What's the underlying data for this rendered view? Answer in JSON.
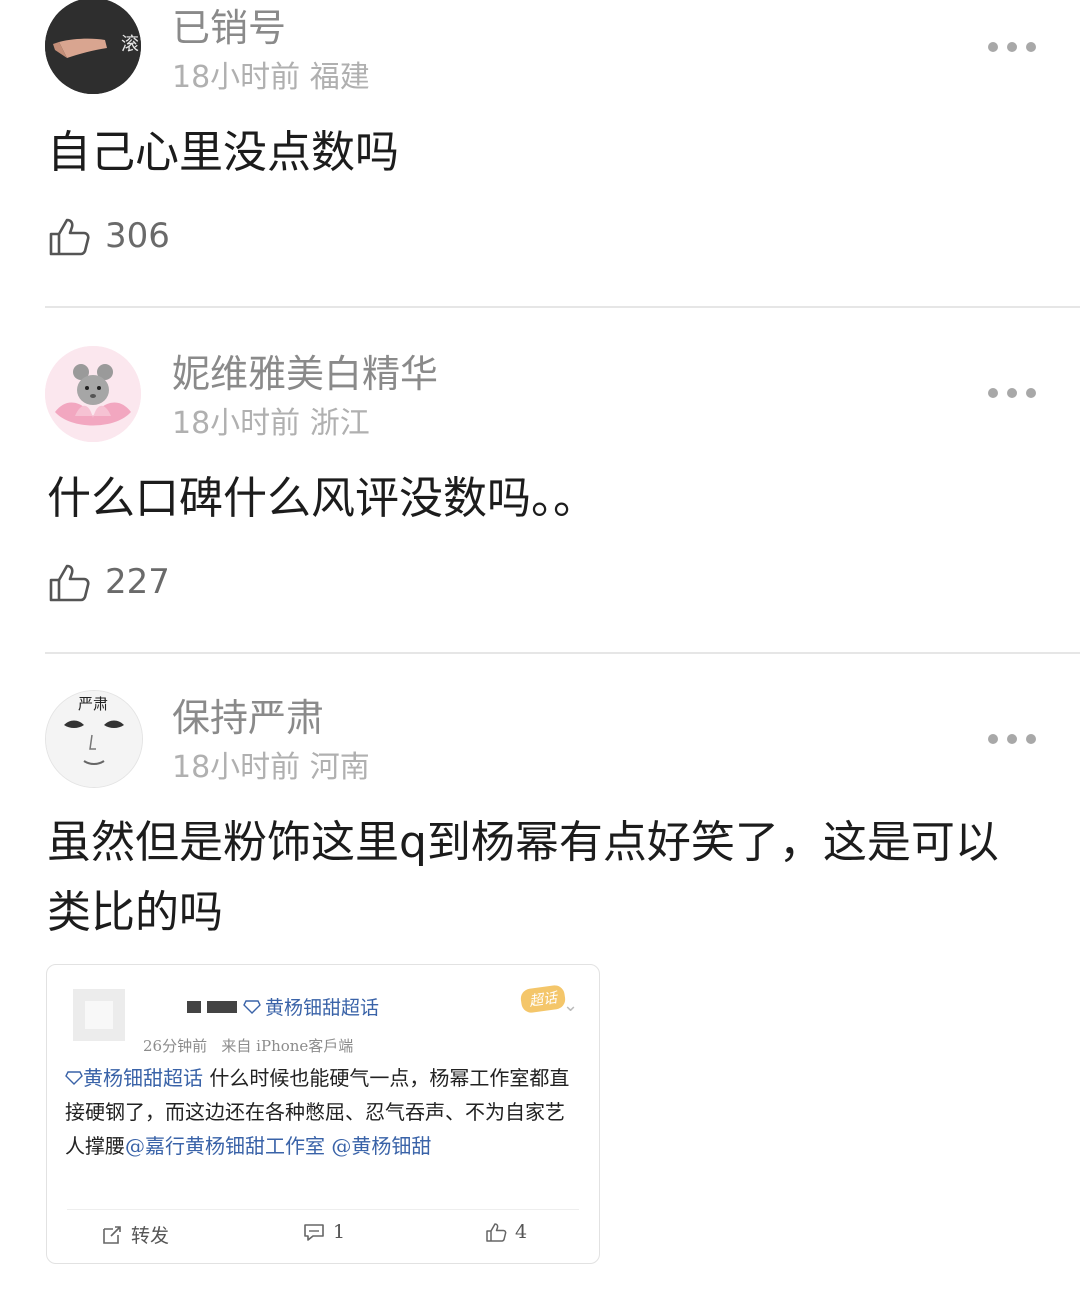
{
  "comments": [
    {
      "username": "已销号",
      "time": "18小时前",
      "location": "福建",
      "text": "自己心里没点数吗",
      "likes": "306",
      "avatar_text": "滚"
    },
    {
      "username": "妮维雅美白精华",
      "time": "18小时前",
      "location": "浙江",
      "text": "什么口碑什么风评没数吗。。",
      "likes": "227"
    },
    {
      "username": "保持严肃",
      "time": "18小时前",
      "location": "河南",
      "text": "虽然但是粉饰这里q到杨幂有点好笑了，这是可以类比的吗",
      "likes": "",
      "avatar_text": "严肃"
    }
  ],
  "embedded_post": {
    "super_topic": "黄杨钿甜超话",
    "tag": "超话",
    "time": "26分钟前",
    "source": "来自 iPhone客戶端",
    "text_link": "黄杨钿甜超话",
    "text_body": " 什么时候也能硬气一点，杨幂工作室都直接硬钢了，而这边还在各种憋屈、忍气吞声、不为自家艺人撑腰",
    "mention1": "@嘉行黄杨钿甜工作室",
    "mention2": "@黄杨钿甜",
    "repost_label": "转发",
    "comment_count": "1",
    "like_count": "4"
  },
  "icons": [
    "more-icon",
    "thumbs-up-icon",
    "repost-icon",
    "comment-icon",
    "chevron-down-icon",
    "diamond-icon"
  ]
}
